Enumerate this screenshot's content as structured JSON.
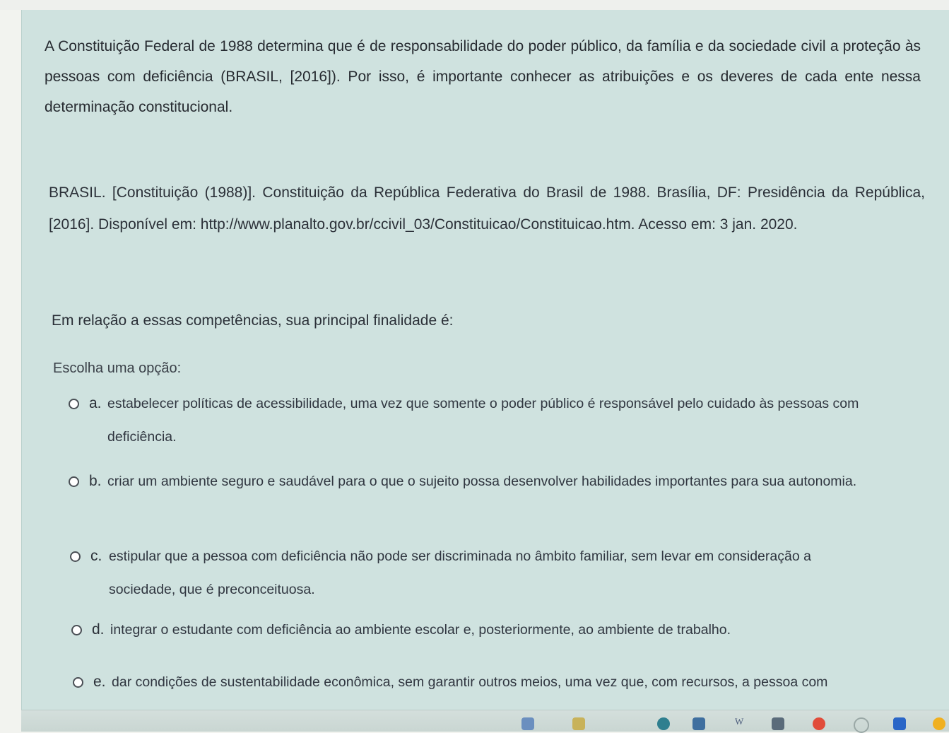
{
  "question": {
    "prompt": "A Constituição Federal de 1988 determina que é de responsabilidade do poder público, da família e da sociedade civil a proteção às pessoas com deficiência (BRASIL, [2016]). Por isso, é importante conhecer as atribuições e os deveres de cada ente nessa determinação constitucional.",
    "reference": "BRASIL. [Constituição (1988)]. Constituição da República Federativa do Brasil de 1988. Brasília, DF: Presidência da República, [2016]. Disponível em: http://www.planalto.gov.br/ccivil_03/Constituicao/Constituicao.htm. Acesso em: 3 jan. 2020.",
    "question_text": "Em relação a essas competências, sua principal finalidade é:",
    "choose_label": "Escolha uma opção:",
    "options": [
      {
        "letter": "a.",
        "text": "estabelecer políticas de acessibilidade, uma vez que somente o poder público é responsável pelo cuidado às pessoas com deficiência."
      },
      {
        "letter": "b.",
        "text": "criar um ambiente seguro e saudável para o que o sujeito possa desenvolver habilidades importantes para sua autonomia."
      },
      {
        "letter": "c.",
        "text": "estipular que a pessoa com deficiência não pode ser discriminada no âmbito familiar, sem levar em consideração a sociedade, que é preconceituosa."
      },
      {
        "letter": "d.",
        "text": "integrar o estudante com deficiência ao ambiente escolar e, posteriormente, ao ambiente de trabalho."
      },
      {
        "letter": "e.",
        "text": "dar condições de sustentabilidade econômica, sem garantir outros meios, uma vez que, com recursos, a pessoa com deficiência pode se desenvolver sozinha."
      }
    ]
  },
  "taskbar": {
    "word_icon_label": "W",
    "icons": [
      "folder-icon",
      "app-icon",
      "word-icon",
      "audio-icon",
      "chrome-icon",
      "wifi-icon",
      "app-blue-icon"
    ]
  },
  "colors": {
    "card_background": "#cfe2df",
    "page_background": "#f2f3ef",
    "text": "#2b2f36"
  }
}
